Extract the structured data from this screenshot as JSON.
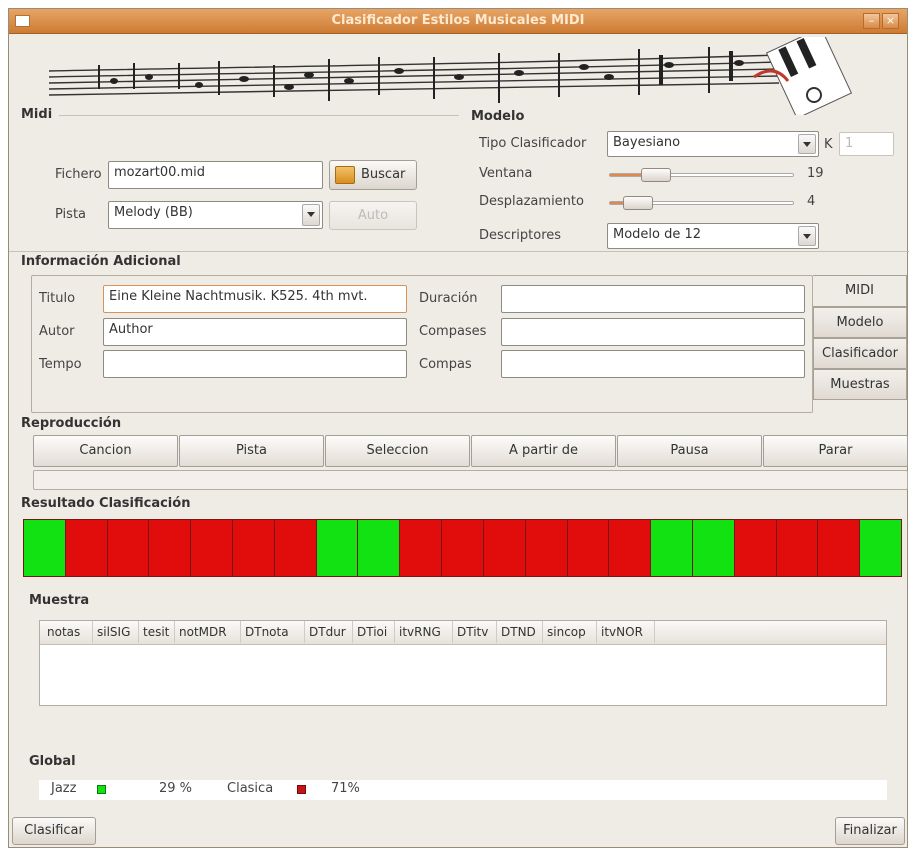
{
  "window": {
    "title": "Clasificador Estilos Musicales MIDI"
  },
  "midi": {
    "section_label": "Midi",
    "fichero_label": "Fichero",
    "fichero_value": "mozart00.mid",
    "buscar_label": "Buscar",
    "pista_label": "Pista",
    "pista_value": "Melody  (BB)",
    "auto_label": "Auto"
  },
  "modelo": {
    "section_label": "Modelo",
    "tipo_label": "Tipo Clasificador",
    "tipo_value": "Bayesiano",
    "k_label": "K",
    "k_value": "1",
    "ventana_label": "Ventana",
    "ventana_value": "19",
    "ventana_level": 0.25,
    "desplazamiento_label": "Desplazamiento",
    "desplazamiento_value": "4",
    "desplazamiento_level": 0.15,
    "descriptores_label": "Descriptores",
    "descriptores_value": "Modelo de 12"
  },
  "info": {
    "section_label": "Información Adicional",
    "titulo_label": "Titulo",
    "titulo_value": "Eine Kleine Nachtmusik. K525. 4th mvt.",
    "autor_label": "Autor",
    "autor_value": "Author",
    "tempo_label": "Tempo",
    "tempo_value": "",
    "duracion_label": "Duración",
    "duracion_value": "",
    "compases_label": "Compases",
    "compases_value": "",
    "compas_label": "Compas",
    "compas_value": "",
    "tabs": [
      "MIDI",
      "Modelo",
      "Clasificador",
      "Muestras"
    ]
  },
  "reproduccion": {
    "section_label": "Reproducción",
    "buttons": [
      "Cancion",
      "Pista",
      "Seleccion",
      "A partir de",
      "Pausa",
      "Parar"
    ]
  },
  "resultado": {
    "section_label": "Resultado Clasificación",
    "segments": [
      "jazz",
      "clasica",
      "clasica",
      "clasica",
      "clasica",
      "clasica",
      "clasica",
      "jazz",
      "jazz",
      "clasica",
      "clasica",
      "clasica",
      "clasica",
      "clasica",
      "clasica",
      "jazz",
      "jazz",
      "clasica",
      "clasica",
      "clasica",
      "jazz"
    ],
    "colors": {
      "jazz": "#12e212",
      "clasica": "#e10d0d"
    }
  },
  "muestra": {
    "section_label": "Muestra",
    "columns": [
      "notas",
      "silSIG",
      "tesit",
      "notMDR",
      "DTnota",
      "DTdur",
      "DTioi",
      "itvRNG",
      "DTitv",
      "DTND",
      "sincop",
      "itvNOR"
    ]
  },
  "global": {
    "section_label": "Global",
    "jazz_label": "Jazz",
    "jazz_pct": "29 %",
    "clasica_label": "Clasica",
    "clasica_pct": "71%"
  },
  "footer": {
    "clasificar_label": "Clasificar",
    "finalizar_label": "Finalizar"
  }
}
